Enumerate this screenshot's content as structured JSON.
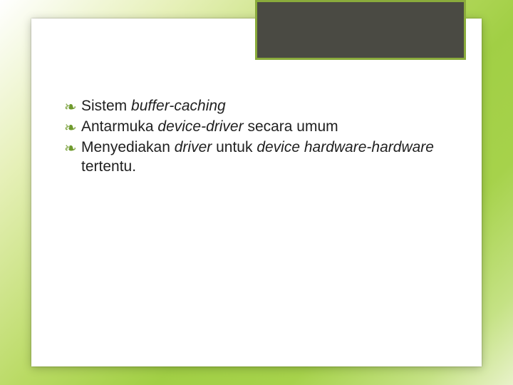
{
  "bullets": [
    {
      "marker": "❧",
      "runs": [
        {
          "text": "Sistem ",
          "italic": false
        },
        {
          "text": "buffer-caching",
          "italic": true
        }
      ]
    },
    {
      "marker": "❧",
      "runs": [
        {
          "text": "Antarmuka ",
          "italic": false
        },
        {
          "text": "device-driver ",
          "italic": true
        },
        {
          "text": "secara umum",
          "italic": false
        }
      ]
    },
    {
      "marker": "❧",
      "runs": [
        {
          "text": "Menyediakan ",
          "italic": false
        },
        {
          "text": "driver ",
          "italic": true
        },
        {
          "text": "untuk ",
          "italic": false
        },
        {
          "text": "device hardware-hardware ",
          "italic": true
        },
        {
          "text": "tertentu.",
          "italic": false
        }
      ]
    }
  ]
}
